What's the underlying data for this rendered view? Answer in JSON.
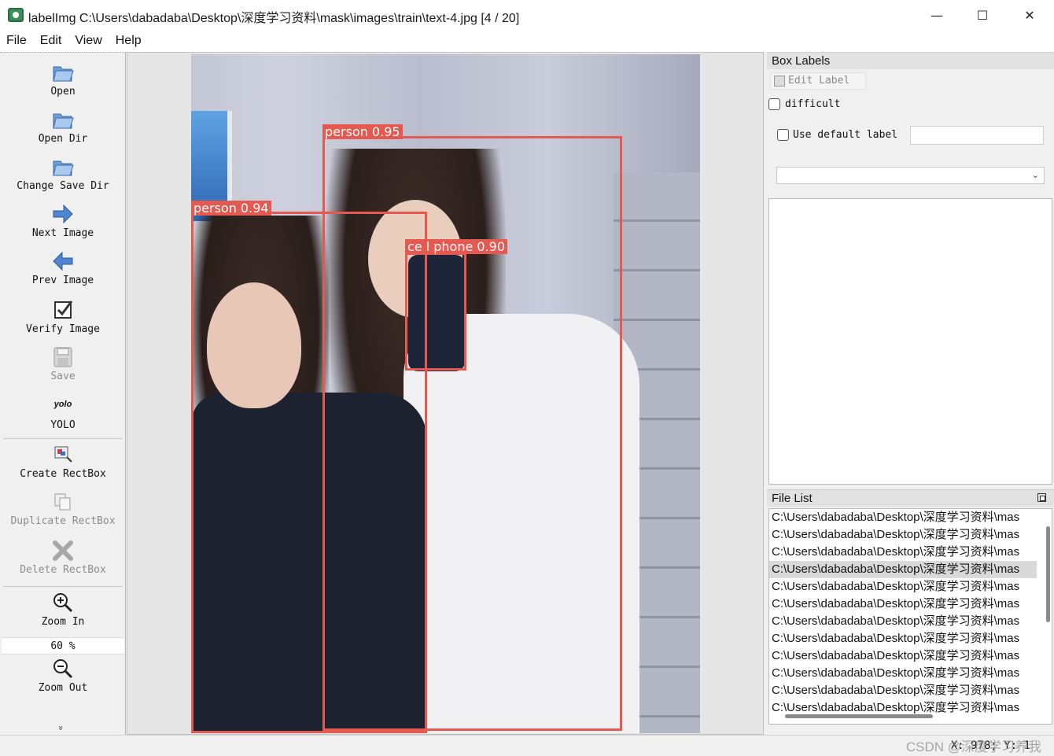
{
  "window": {
    "title": "labelImg C:\\Users\\dabadaba\\Desktop\\深度学习资料\\mask\\images\\train\\text-4.jpg [4 / 20]",
    "minimize": "—",
    "maximize": "☐",
    "close": "✕"
  },
  "menu": [
    "File",
    "Edit",
    "View",
    "Help"
  ],
  "toolbar": {
    "open": "Open",
    "open_dir": "Open Dir",
    "change_save_dir": "Change Save Dir",
    "next_image": "Next Image",
    "prev_image": "Prev Image",
    "verify_image": "Verify Image",
    "save": "Save",
    "format_icon_text": "yolo",
    "format": "YOLO",
    "create_rectbox": "Create RectBox",
    "duplicate_rectbox": "Duplicate RectBox",
    "delete_rectbox": "Delete RectBox",
    "zoom_in": "Zoom In",
    "zoom_level": "60 %",
    "zoom_out": "Zoom Out",
    "more": "»"
  },
  "canvas": {
    "detections": [
      {
        "label": "person 0.95"
      },
      {
        "label": "person 0.94"
      },
      {
        "label": "ce l phone 0.90"
      }
    ],
    "box_color": "#e55a50"
  },
  "box_labels": {
    "title": "Box Labels",
    "edit_label": "Edit Label",
    "difficult": "difficult",
    "use_default_label": "Use default label",
    "default_label_value": "",
    "combo_value": ""
  },
  "file_list": {
    "title": "File List",
    "selected_index": 3,
    "items": [
      "C:\\Users\\dabadaba\\Desktop\\深度学习资料\\mas",
      "C:\\Users\\dabadaba\\Desktop\\深度学习资料\\mas",
      "C:\\Users\\dabadaba\\Desktop\\深度学习资料\\mas",
      "C:\\Users\\dabadaba\\Desktop\\深度学习资料\\mas",
      "C:\\Users\\dabadaba\\Desktop\\深度学习资料\\mas",
      "C:\\Users\\dabadaba\\Desktop\\深度学习资料\\mas",
      "C:\\Users\\dabadaba\\Desktop\\深度学习资料\\mas",
      "C:\\Users\\dabadaba\\Desktop\\深度学习资料\\mas",
      "C:\\Users\\dabadaba\\Desktop\\深度学习资料\\mas",
      "C:\\Users\\dabadaba\\Desktop\\深度学习资料\\mas",
      "C:\\Users\\dabadaba\\Desktop\\深度学习资料\\mas",
      "C:\\Users\\dabadaba\\Desktop\\深度学习资料\\mas"
    ]
  },
  "status": {
    "coords": "X: 978; Y: 1",
    "watermark": "CSDN @深度学习养我"
  }
}
